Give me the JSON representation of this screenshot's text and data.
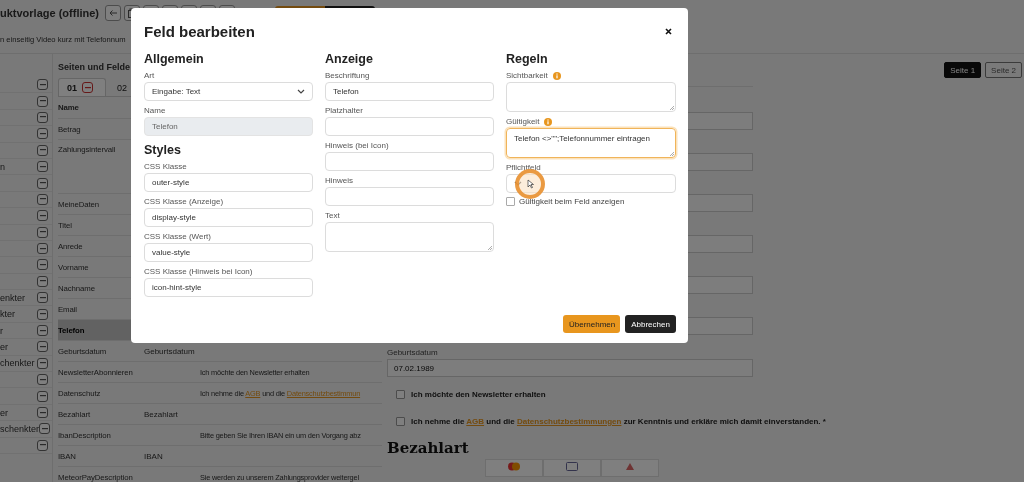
{
  "app": {
    "title": "uktvorlage (offline)",
    "subtitle": "n einseitig Video kurz mit Telefonnum",
    "toolbar": [
      {
        "kind": "back"
      },
      {
        "kind": "copy"
      },
      {
        "kind": "document"
      },
      {
        "kind": "upload"
      },
      {
        "kind": "upload"
      },
      {
        "kind": "download"
      },
      {
        "kind": "box"
      }
    ],
    "actions": [
      {
        "kind": "primary"
      },
      {
        "kind": "dark"
      }
    ]
  },
  "sidebar": {
    "items": [
      {
        "removable": true
      },
      {
        "removable": true
      },
      {
        "removable": true
      },
      {
        "removable": true
      },
      {
        "removable": true
      },
      {
        "label": "n",
        "removable": true
      },
      {
        "removable": true
      },
      {
        "removable": true
      },
      {
        "removable": true
      },
      {
        "removable": true
      },
      {
        "removable": true
      },
      {
        "removable": true
      },
      {
        "removable": true
      },
      {
        "label": "enkter",
        "removable": true
      },
      {
        "label": "kter",
        "removable": true
      },
      {
        "label": "r",
        "removable": true
      },
      {
        "label": "er",
        "removable": true
      },
      {
        "label": "chenkter",
        "removable": true
      },
      {
        "removable": true
      },
      {
        "removable": true
      },
      {
        "label": "er",
        "removable": true
      },
      {
        "label": "schenkter",
        "removable": true
      },
      {
        "removable": true
      }
    ]
  },
  "pages_panel": {
    "title": "Seiten und Felde",
    "tabs": [
      {
        "label": "01",
        "selected": true
      },
      {
        "label": "02",
        "selected": false
      }
    ],
    "columns": [
      "Name"
    ],
    "rows": [
      {
        "kind": "field",
        "name": "Betrag",
        "selected": false
      },
      {
        "kind": "options",
        "name": "Zahlungsintervall",
        "selected": false
      },
      {
        "kind": "field",
        "name": "MeineDaten",
        "selected": false
      },
      {
        "kind": "field",
        "name": "Titel",
        "selected": false
      },
      {
        "kind": "field",
        "name": "Anrede",
        "selected": false
      },
      {
        "kind": "field",
        "name": "Vorname",
        "selected": false
      },
      {
        "kind": "field",
        "name": "Nachname",
        "selected": false
      },
      {
        "kind": "field",
        "name": "Email",
        "selected": false
      },
      {
        "kind": "field",
        "name": "Telefon",
        "selected": true
      },
      {
        "kind": "field",
        "name": "Geburtsdatum",
        "column_2": "Geburtsdatum",
        "selected": false
      },
      {
        "kind": "field",
        "name": "NewsletterAbonnieren",
        "column_3": [
          {
            "text": "Ich möchte den Newsletter erhalten"
          }
        ],
        "selected": false
      },
      {
        "kind": "field",
        "name": "Datenschutz",
        "column_3": [
          {
            "text": "Ich nehme die "
          },
          {
            "text": "AGB",
            "link": true
          },
          {
            "text": " und die "
          },
          {
            "text": "Datenschutzbestimmun",
            "link": true
          }
        ],
        "selected": false
      },
      {
        "kind": "field",
        "name": "Bezahlart",
        "column_2": "Bezahlart",
        "selected": false
      },
      {
        "kind": "field",
        "name": "IbanDescription",
        "column_3": [
          {
            "text": "Bitte geben Sie Ihren IBAN ein um den Vorgang abz"
          }
        ],
        "selected": false
      },
      {
        "kind": "field",
        "name": "IBAN",
        "column_2": "IBAN",
        "selected": false
      },
      {
        "kind": "field",
        "name": "MeteorPayDescription",
        "column_3": [
          {
            "text": "Sie werden zu unserem Zahlungsprovider weitergel"
          }
        ],
        "selected": false
      }
    ]
  },
  "preview": {
    "page_buttons": [
      {
        "label": "Seite 1",
        "selected": true
      },
      {
        "label": "Seite 2",
        "selected": false
      }
    ],
    "items": [
      {
        "kind": "select"
      },
      {
        "kind": "input"
      },
      {
        "kind": "select"
      },
      {
        "kind": "input"
      },
      {
        "kind": "input"
      },
      {
        "kind": "input"
      },
      {
        "kind": "input",
        "label": "Geburtsdatum",
        "value": "07.02.1989"
      },
      {
        "kind": "checkbox",
        "checked": false,
        "parts": [
          {
            "text": "Ich möchte den Newsletter erhalten"
          }
        ]
      },
      {
        "kind": "checkbox",
        "checked": false,
        "parts": [
          {
            "text": "Ich nehme die "
          },
          {
            "text": "AGB",
            "link": true
          },
          {
            "text": " und die "
          },
          {
            "text": "Datenschutzbestimmungen",
            "link": true
          },
          {
            "text": " zur Kenntnis und erkläre mich damit einverstanden. *"
          }
        ]
      },
      {
        "kind": "heading",
        "text": "Bezahlart"
      }
    ],
    "payment_options": [
      {
        "kind": "circles"
      },
      {
        "kind": "card"
      },
      {
        "kind": "logo"
      }
    ]
  },
  "dialog": {
    "title": "Feld bearbeiten",
    "columns": [
      {
        "heading": "Allgemein",
        "items": [
          {
            "kind": "select",
            "label": "Art",
            "value": "Eingabe: Text"
          },
          {
            "kind": "input",
            "label": "Name",
            "value": "Telefon",
            "disabled": true
          },
          {
            "kind": "heading",
            "text": "Styles"
          },
          {
            "kind": "input",
            "label": "CSS Klasse",
            "value": "outer-style"
          },
          {
            "kind": "input",
            "label": "CSS Klasse (Anzeige)",
            "value": "display-style"
          },
          {
            "kind": "input",
            "label": "CSS Klasse (Wert)",
            "value": "value-style"
          },
          {
            "kind": "input",
            "label": "CSS Klasse (Hinweis bei Icon)",
            "value": "icon-hint-style"
          }
        ]
      },
      {
        "heading": "Anzeige",
        "items": [
          {
            "kind": "input",
            "label": "Beschriftung",
            "value": "Telefon"
          },
          {
            "kind": "input",
            "label": "Platzhalter"
          },
          {
            "kind": "input",
            "label": "Hinweis (bei Icon)"
          },
          {
            "kind": "input",
            "label": "Hinweis"
          },
          {
            "kind": "textarea",
            "label": "Text"
          }
        ]
      },
      {
        "heading": "Regeln",
        "items": [
          {
            "kind": "textarea",
            "label": "Sichtbarkeit",
            "info": true
          },
          {
            "kind": "textarea",
            "label": "Gültigkeit",
            "info": true,
            "focused": true,
            "value": "Telefon <>\"\";Telefonnummer eintragen"
          },
          {
            "kind": "select",
            "label": "Pflichtfeld"
          },
          {
            "kind": "checkbox",
            "label": "Gültigkeit beim Feld anzeigen",
            "checked": false
          }
        ]
      }
    ],
    "buttons": [
      {
        "label": "Übernehmen",
        "kind": "primary"
      },
      {
        "label": "Abbrechen",
        "kind": "dark"
      }
    ]
  }
}
